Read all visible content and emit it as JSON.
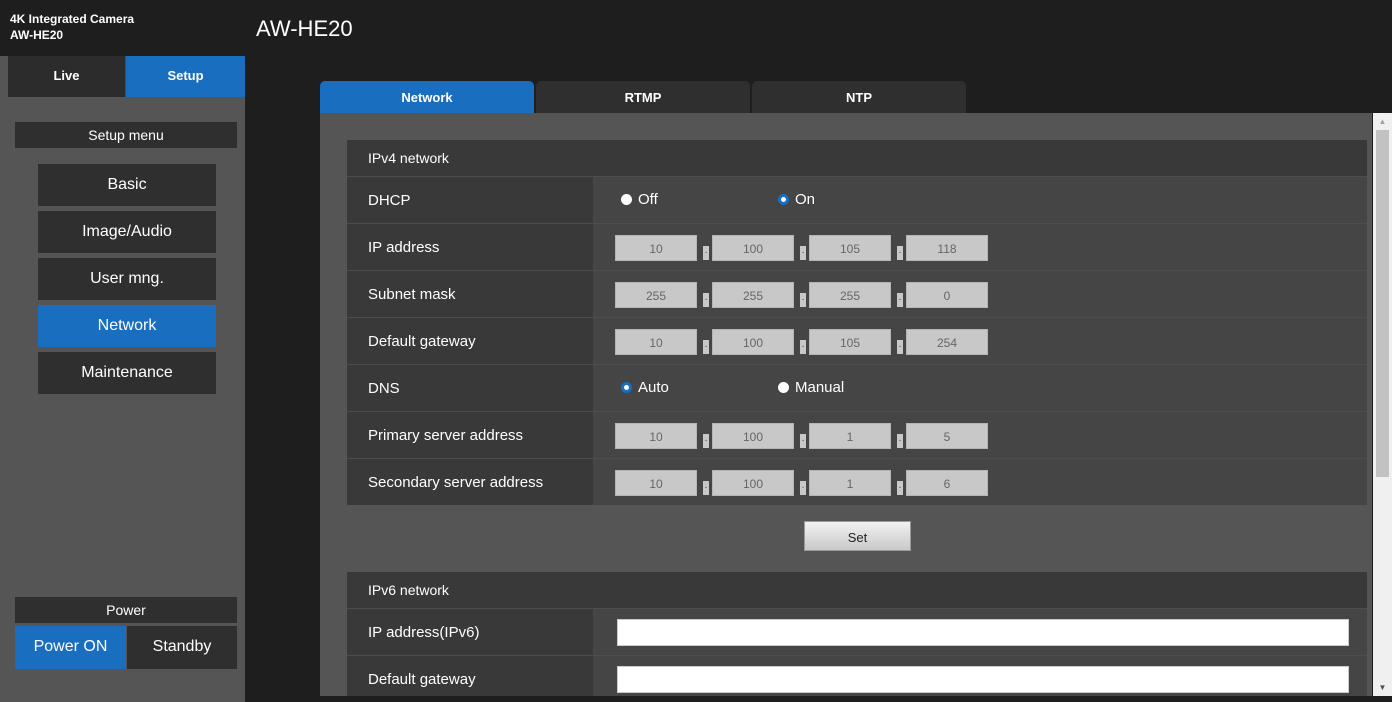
{
  "brand": {
    "line1": "4K Integrated Camera",
    "line2": "AW-HE20"
  },
  "mode_tabs": {
    "live": "Live",
    "setup": "Setup"
  },
  "sidebar": {
    "menu_title": "Setup menu",
    "items": [
      {
        "label": "Basic"
      },
      {
        "label": "Image/Audio"
      },
      {
        "label": "User mng."
      },
      {
        "label": "Network",
        "active": true
      },
      {
        "label": "Maintenance"
      }
    ],
    "power_title": "Power",
    "power_on": "Power ON",
    "standby": "Standby"
  },
  "header": {
    "title": "AW-HE20"
  },
  "tabs": [
    {
      "label": "Network",
      "active": true
    },
    {
      "label": "RTMP"
    },
    {
      "label": "NTP"
    }
  ],
  "ipv4": {
    "title": "IPv4 network",
    "dhcp": {
      "label": "DHCP",
      "off": "Off",
      "on": "On",
      "selected": "On"
    },
    "ip_address": {
      "label": "IP address",
      "octets": [
        "10",
        "100",
        "105",
        "118"
      ]
    },
    "subnet_mask": {
      "label": "Subnet mask",
      "octets": [
        "255",
        "255",
        "255",
        "0"
      ]
    },
    "default_gateway": {
      "label": "Default gateway",
      "octets": [
        "10",
        "100",
        "105",
        "254"
      ]
    },
    "dns": {
      "label": "DNS",
      "auto": "Auto",
      "manual": "Manual",
      "selected": "Auto"
    },
    "primary_server": {
      "label": "Primary server address",
      "octets": [
        "10",
        "100",
        "1",
        "5"
      ]
    },
    "secondary_server": {
      "label": "Secondary server address",
      "octets": [
        "10",
        "100",
        "1",
        "6"
      ]
    },
    "set_label": "Set"
  },
  "ipv6": {
    "title": "IPv6 network",
    "ip_address": {
      "label": "IP address(IPv6)",
      "value": ""
    },
    "default_gateway": {
      "label": "Default gateway",
      "value": ""
    }
  },
  "colors": {
    "accent": "#1a6ec0",
    "panel": "#555555",
    "row": "#393939"
  }
}
